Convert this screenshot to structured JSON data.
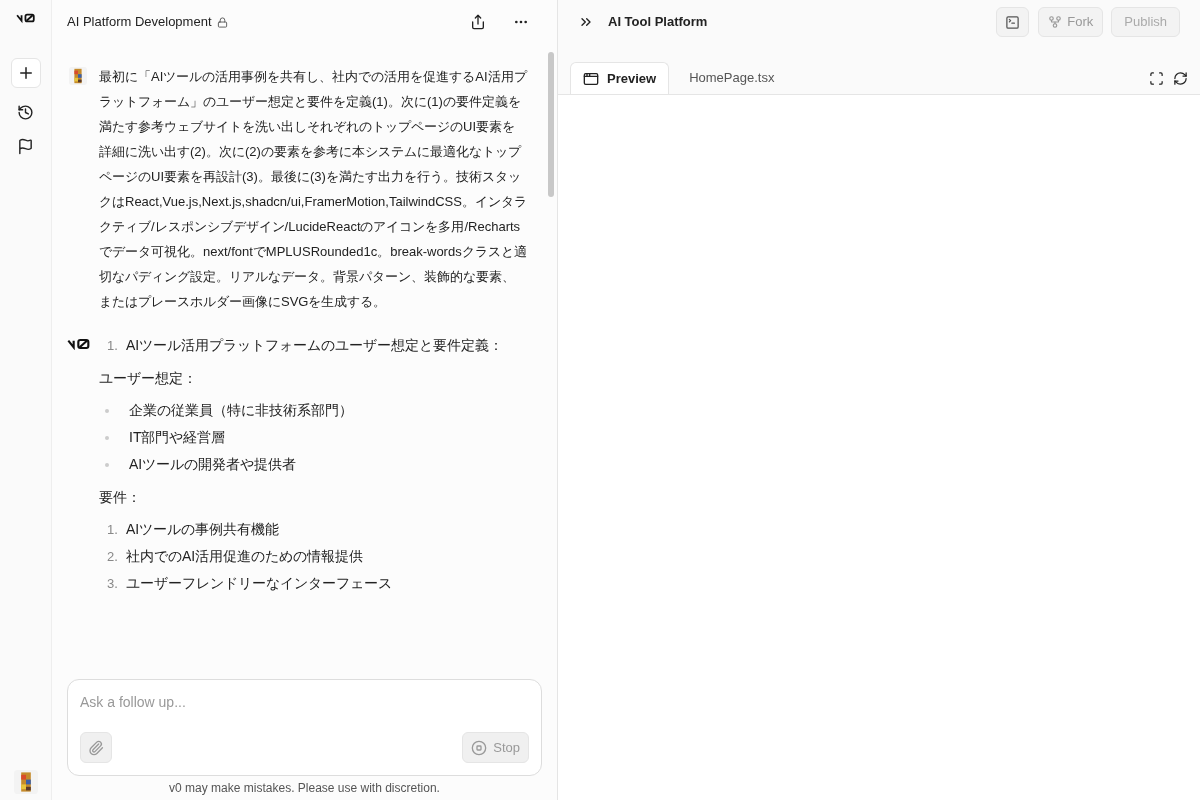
{
  "chat": {
    "title": "AI Platform Development",
    "user_message": "最初に「AIツールの活用事例を共有し、社内での活用を促進するAI活用プラットフォーム」のユーザー想定と要件を定義(1)。次に(1)の要件定義を満たす参考ウェブサイトを洗い出しそれぞれのトップページのUI要素を詳細に洗い出す(2)。次に(2)の要素を参考に本システムに最適化なトップページのUI要素を再設計(3)。最後に(3)を満たす出力を行う。技術スタックはReact,Vue.js,Next.js,shadcn/ui,FramerMotion,TailwindCSS。インタラクティブ/レスポンシブデザイン/LucideReactのアイコンを多用/Rechartsでデータ可視化。next/fontでMPLUSRounded1c。break-wordsクラスと適切なパディング設定。リアルなデータ。背景パターン、装飾的な要素、またはプレースホルダー画像にSVGを生成する。",
    "reply": [
      {
        "kind": "ordered",
        "number": "1.",
        "text": "AIツール活用プラットフォームのユーザー想定と要件定義："
      },
      {
        "kind": "paragraph",
        "text": "ユーザー想定："
      },
      {
        "kind": "bullet",
        "text": "企業の従業員（特に非技術系部門）"
      },
      {
        "kind": "bullet",
        "text": "IT部門や経営層"
      },
      {
        "kind": "bullet",
        "text": "AIツールの開発者や提供者"
      },
      {
        "kind": "paragraph",
        "text": "要件："
      },
      {
        "kind": "ordered",
        "number": "1.",
        "text": "AIツールの事例共有機能"
      },
      {
        "kind": "ordered",
        "number": "2.",
        "text": "社内でのAI活用促進のための情報提供"
      },
      {
        "kind": "ordered",
        "number": "3.",
        "text": "ユーザーフレンドリーなインターフェース"
      }
    ],
    "composer": {
      "placeholder": "Ask a follow up...",
      "stop_label": "Stop"
    },
    "disclaimer": "v0 may make mistakes. Please use with discretion."
  },
  "preview": {
    "title": "AI Tool Platform",
    "fork_label": "Fork",
    "publish_label": "Publish",
    "tabs": [
      {
        "label": "Preview",
        "selected": true
      },
      {
        "label": "HomePage.tsx",
        "selected": false
      }
    ]
  }
}
